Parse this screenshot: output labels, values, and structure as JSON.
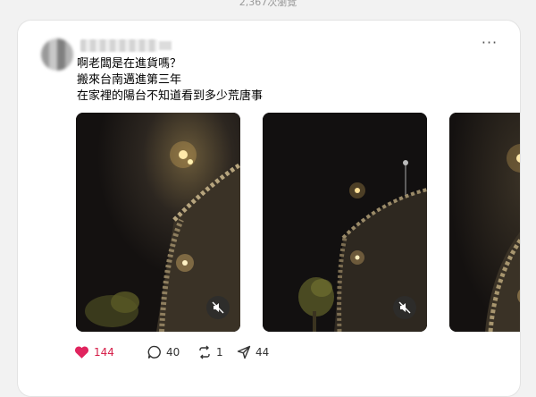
{
  "top": {
    "view_count": "2,367次瀏覽"
  },
  "post": {
    "more_label": "···",
    "lines": [
      "啊老闆是在進貨嗎？",
      "搬來台南邁進第三年",
      "在家裡的陽台不知道看到多少荒唐事"
    ]
  },
  "actions": {
    "likes": "144",
    "comments": "40",
    "reposts": "1",
    "shares": "44",
    "like_color": "#e0245e"
  },
  "icons": [
    "more-icon",
    "mute-icon",
    "heart-icon",
    "comment-icon",
    "repost-icon",
    "share-icon"
  ]
}
